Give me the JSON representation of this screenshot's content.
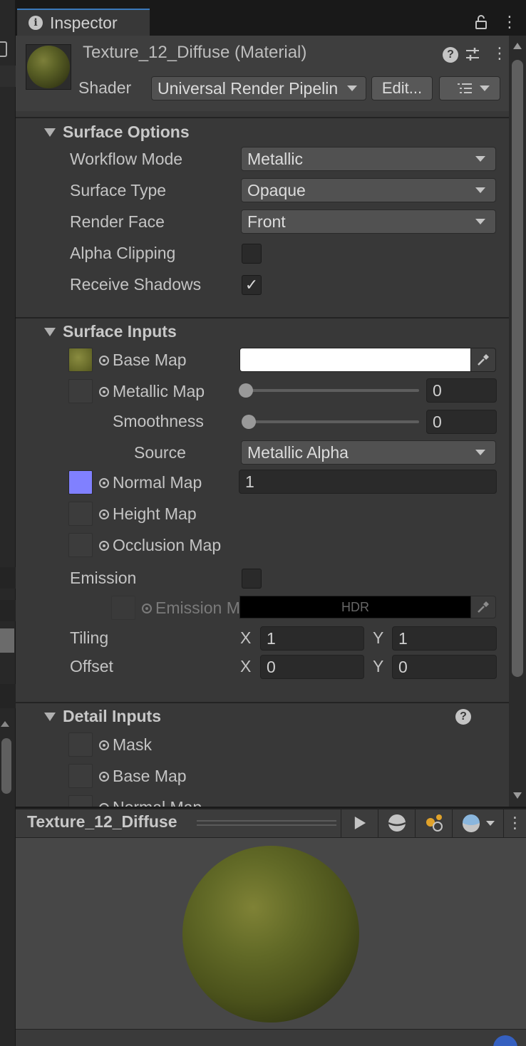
{
  "window": {
    "tab_label": "Inspector",
    "tab_icon": "info-icon",
    "lock_icon": "lock-icon",
    "menu_icon": "kebab-icon"
  },
  "header": {
    "material_name": "Texture_12_Diffuse (Material)",
    "shader_label": "Shader",
    "shader_value": "Universal Render Pipelin",
    "edit_button": "Edit...",
    "help_icon": "help-icon",
    "settings_icon": "sliders-icon",
    "menu_icon": "kebab-icon"
  },
  "surface_options": {
    "title": "Surface Options",
    "workflow_mode_label": "Workflow Mode",
    "workflow_mode_value": "Metallic",
    "surface_type_label": "Surface Type",
    "surface_type_value": "Opaque",
    "render_face_label": "Render Face",
    "render_face_value": "Front",
    "alpha_clipping_label": "Alpha Clipping",
    "alpha_clipping_checked": false,
    "receive_shadows_label": "Receive Shadows",
    "receive_shadows_checked": true,
    "checkmark": "✓"
  },
  "surface_inputs": {
    "title": "Surface Inputs",
    "base_map_label": "Base Map",
    "base_map_color": "#ffffff",
    "metallic_map_label": "Metallic Map",
    "metallic_value": "0",
    "smoothness_label": "Smoothness",
    "smoothness_value": "0",
    "source_label": "Source",
    "source_value": "Metallic Alpha",
    "normal_map_label": "Normal Map",
    "normal_map_value": "1",
    "height_map_label": "Height Map",
    "occlusion_map_label": "Occlusion Map",
    "emission_label": "Emission",
    "emission_checked": false,
    "emission_map_label": "Emission M",
    "emission_hdr_label": "HDR",
    "tiling_label": "Tiling",
    "tiling_x_label": "X",
    "tiling_x": "1",
    "tiling_y_label": "Y",
    "tiling_y": "1",
    "offset_label": "Offset",
    "offset_x_label": "X",
    "offset_x": "0",
    "offset_y_label": "Y",
    "offset_y": "0"
  },
  "detail_inputs": {
    "title": "Detail Inputs",
    "mask_label": "Mask",
    "base_map_label": "Base Map",
    "normal_map_label": "Normal Map"
  },
  "preview": {
    "title": "Texture_12_Diffuse",
    "play_icon": "play-icon",
    "shape_icon": "sphere-shape-icon",
    "lights_icon": "lights-icon",
    "sky_icon": "skybox-icon",
    "menu_icon": "kebab-icon"
  },
  "colors": {
    "accent": "#3a79bb",
    "normal_map_swatch": "#8080ff",
    "base_map_swatch": "#7c7f3a"
  }
}
